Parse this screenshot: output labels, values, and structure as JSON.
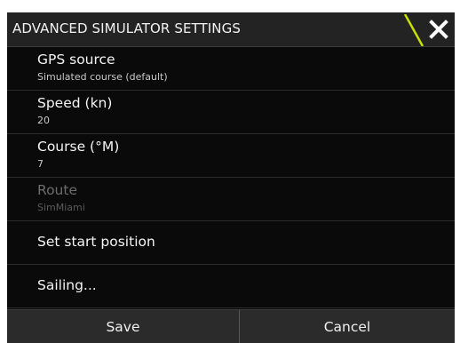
{
  "dialog": {
    "title": "ADVANCED SIMULATOR SETTINGS",
    "accent_color": "#c8e000",
    "close_icon": "close-icon"
  },
  "settings": [
    {
      "label": "GPS source",
      "value": "Simulated course (default)",
      "enabled": true
    },
    {
      "label": "Speed (kn)",
      "value": "20",
      "enabled": true
    },
    {
      "label": "Course (°M)",
      "value": "7",
      "enabled": true
    },
    {
      "label": "Route",
      "value": "SimMiami",
      "enabled": false
    },
    {
      "label": "Set start position",
      "value": "",
      "enabled": true
    },
    {
      "label": "Sailing...",
      "value": "",
      "enabled": true
    }
  ],
  "footer": {
    "save_label": "Save",
    "cancel_label": "Cancel"
  }
}
